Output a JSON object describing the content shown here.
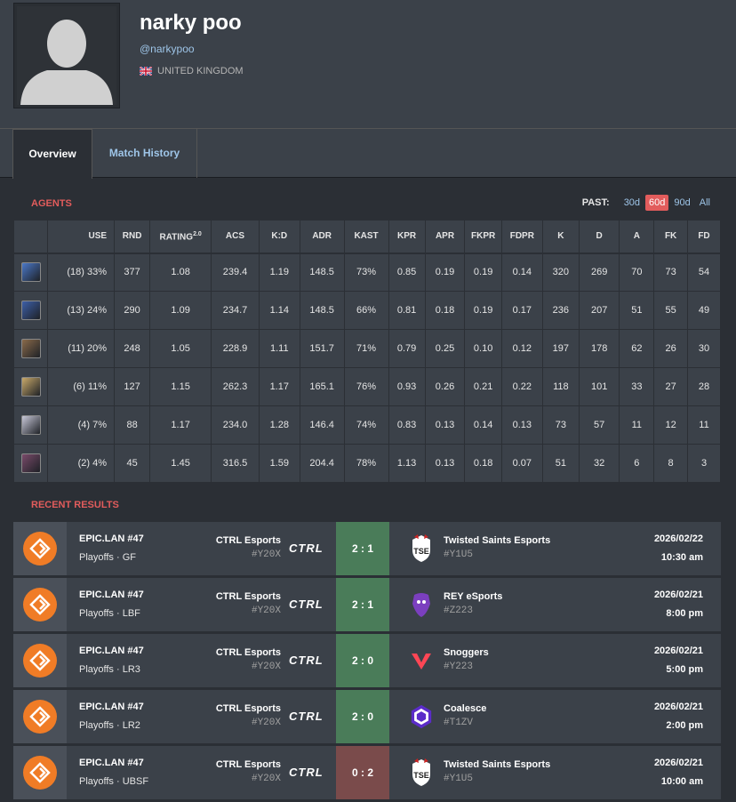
{
  "profile": {
    "name": "narky poo",
    "handle": "@narkypoo",
    "country": "UNITED KINGDOM"
  },
  "tabs": [
    {
      "label": "Overview",
      "active": true
    },
    {
      "label": "Match History",
      "active": false
    }
  ],
  "agents_section": {
    "title": "AGENTS",
    "past_label": "PAST:",
    "options": [
      "30d",
      "60d",
      "90d",
      "All"
    ],
    "selected": "60d"
  },
  "agents_table": {
    "headers": [
      "USE",
      "RND",
      "RATING",
      "ACS",
      "K:D",
      "ADR",
      "KAST",
      "KPR",
      "APR",
      "FKPR",
      "FDPR",
      "K",
      "D",
      "A",
      "FK",
      "FD"
    ],
    "rating_sup": "2.0",
    "rows": [
      {
        "icon_color": "#4a78c8",
        "use": "(18) 33%",
        "rnd": "377",
        "rating": "1.08",
        "acs": "239.4",
        "kd": "1.19",
        "adr": "148.5",
        "kast": "73%",
        "kpr": "0.85",
        "apr": "0.19",
        "fkpr": "0.19",
        "fdpr": "0.14",
        "k": "320",
        "d": "269",
        "a": "70",
        "fk": "73",
        "fd": "54"
      },
      {
        "icon_color": "#3d5fa8",
        "use": "(13) 24%",
        "rnd": "290",
        "rating": "1.09",
        "acs": "234.7",
        "kd": "1.14",
        "adr": "148.5",
        "kast": "66%",
        "kpr": "0.81",
        "apr": "0.18",
        "fkpr": "0.19",
        "fdpr": "0.17",
        "k": "236",
        "d": "207",
        "a": "51",
        "fk": "55",
        "fd": "49"
      },
      {
        "icon_color": "#8a6a4a",
        "use": "(11) 20%",
        "rnd": "248",
        "rating": "1.05",
        "acs": "228.9",
        "kd": "1.11",
        "adr": "151.7",
        "kast": "71%",
        "kpr": "0.79",
        "apr": "0.25",
        "fkpr": "0.10",
        "fdpr": "0.12",
        "k": "197",
        "d": "178",
        "a": "62",
        "fk": "26",
        "fd": "30"
      },
      {
        "icon_color": "#c9a96a",
        "use": "(6) 11%",
        "rnd": "127",
        "rating": "1.15",
        "acs": "262.3",
        "kd": "1.17",
        "adr": "165.1",
        "kast": "76%",
        "kpr": "0.93",
        "apr": "0.26",
        "fkpr": "0.21",
        "fdpr": "0.22",
        "k": "118",
        "d": "101",
        "a": "33",
        "fk": "27",
        "fd": "28"
      },
      {
        "icon_color": "#c8c8d8",
        "use": "(4) 7%",
        "rnd": "88",
        "rating": "1.17",
        "acs": "234.0",
        "kd": "1.28",
        "adr": "146.4",
        "kast": "74%",
        "kpr": "0.83",
        "apr": "0.13",
        "fkpr": "0.14",
        "fdpr": "0.13",
        "k": "73",
        "d": "57",
        "a": "11",
        "fk": "12",
        "fd": "11"
      },
      {
        "icon_color": "#7a4a6a",
        "use": "(2) 4%",
        "rnd": "45",
        "rating": "1.45",
        "acs": "316.5",
        "kd": "1.59",
        "adr": "204.4",
        "kast": "78%",
        "kpr": "1.13",
        "apr": "0.13",
        "fkpr": "0.18",
        "fdpr": "0.07",
        "k": "51",
        "d": "32",
        "a": "6",
        "fk": "8",
        "fd": "3"
      }
    ]
  },
  "results_section": {
    "title": "RECENT RESULTS"
  },
  "matches": [
    {
      "event": "EPIC.LAN #47",
      "stage": "Playoffs · GF",
      "team1": "CTRL Esports",
      "team1_tag": "#Y20X",
      "team1_logo": "CTRL",
      "score": "2 : 1",
      "result": "win",
      "team2": "Twisted Saints Esports",
      "team2_tag": "#Y1U5",
      "team2_logo": "tse",
      "date": "2026/02/22",
      "time": "10:30 am"
    },
    {
      "event": "EPIC.LAN #47",
      "stage": "Playoffs · LBF",
      "team1": "CTRL Esports",
      "team1_tag": "#Y20X",
      "team1_logo": "CTRL",
      "score": "2 : 1",
      "result": "win",
      "team2": "REY eSports",
      "team2_tag": "#Z223",
      "team2_logo": "rey",
      "date": "2026/02/21",
      "time": "8:00 pm"
    },
    {
      "event": "EPIC.LAN #47",
      "stage": "Playoffs · LR3",
      "team1": "CTRL Esports",
      "team1_tag": "#Y20X",
      "team1_logo": "CTRL",
      "score": "2 : 0",
      "result": "win",
      "team2": "Snoggers",
      "team2_tag": "#Y223",
      "team2_logo": "snog",
      "date": "2026/02/21",
      "time": "5:00 pm"
    },
    {
      "event": "EPIC.LAN #47",
      "stage": "Playoffs · LR2",
      "team1": "CTRL Esports",
      "team1_tag": "#Y20X",
      "team1_logo": "CTRL",
      "score": "2 : 0",
      "result": "win",
      "team2": "Coalesce",
      "team2_tag": "#T1ZV",
      "team2_logo": "coal",
      "date": "2026/02/21",
      "time": "2:00 pm"
    },
    {
      "event": "EPIC.LAN #47",
      "stage": "Playoffs · UBSF",
      "team1": "CTRL Esports",
      "team1_tag": "#Y20X",
      "team1_logo": "CTRL",
      "score": "0 : 2",
      "result": "loss",
      "team2": "Twisted Saints Esports",
      "team2_tag": "#Y1U5",
      "team2_logo": "tse",
      "date": "2026/02/21",
      "time": "10:00 am"
    }
  ]
}
